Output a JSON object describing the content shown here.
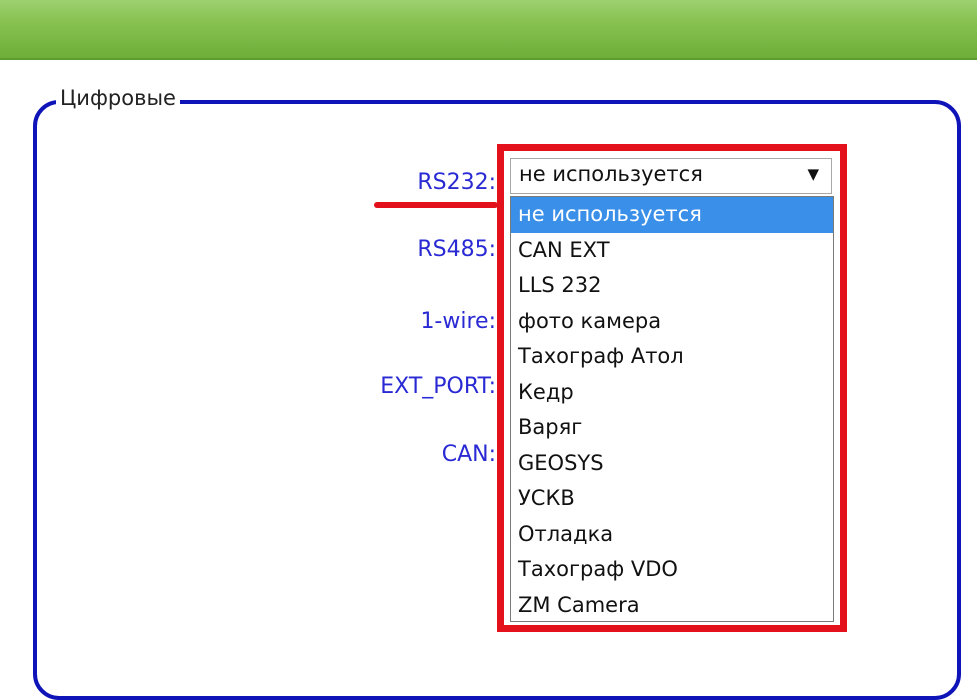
{
  "legend": "Цифровые",
  "labels": {
    "rs232": "RS232:",
    "rs485": "RS485:",
    "onewire": "1-wire:",
    "ext_port": "EXT_PORT:",
    "can": "CAN:"
  },
  "rs232_select": {
    "value": "не используется",
    "arrow": "▼",
    "options": [
      "не используется",
      "CAN EXT",
      "LLS 232",
      "фото камера",
      "Тахограф Атол",
      "Кедр",
      "Варяг",
      "GEOSYS",
      "УСКВ",
      "Отладка",
      "Тахограф VDO",
      "ZM Camera"
    ],
    "selected_index": 0
  },
  "colors": {
    "header_green": "#86c14f",
    "frame_blue": "#0f14b8",
    "label_blue": "#2a2ad4",
    "annotation_red": "#e3111c",
    "selection_blue": "#3a8fe8"
  }
}
